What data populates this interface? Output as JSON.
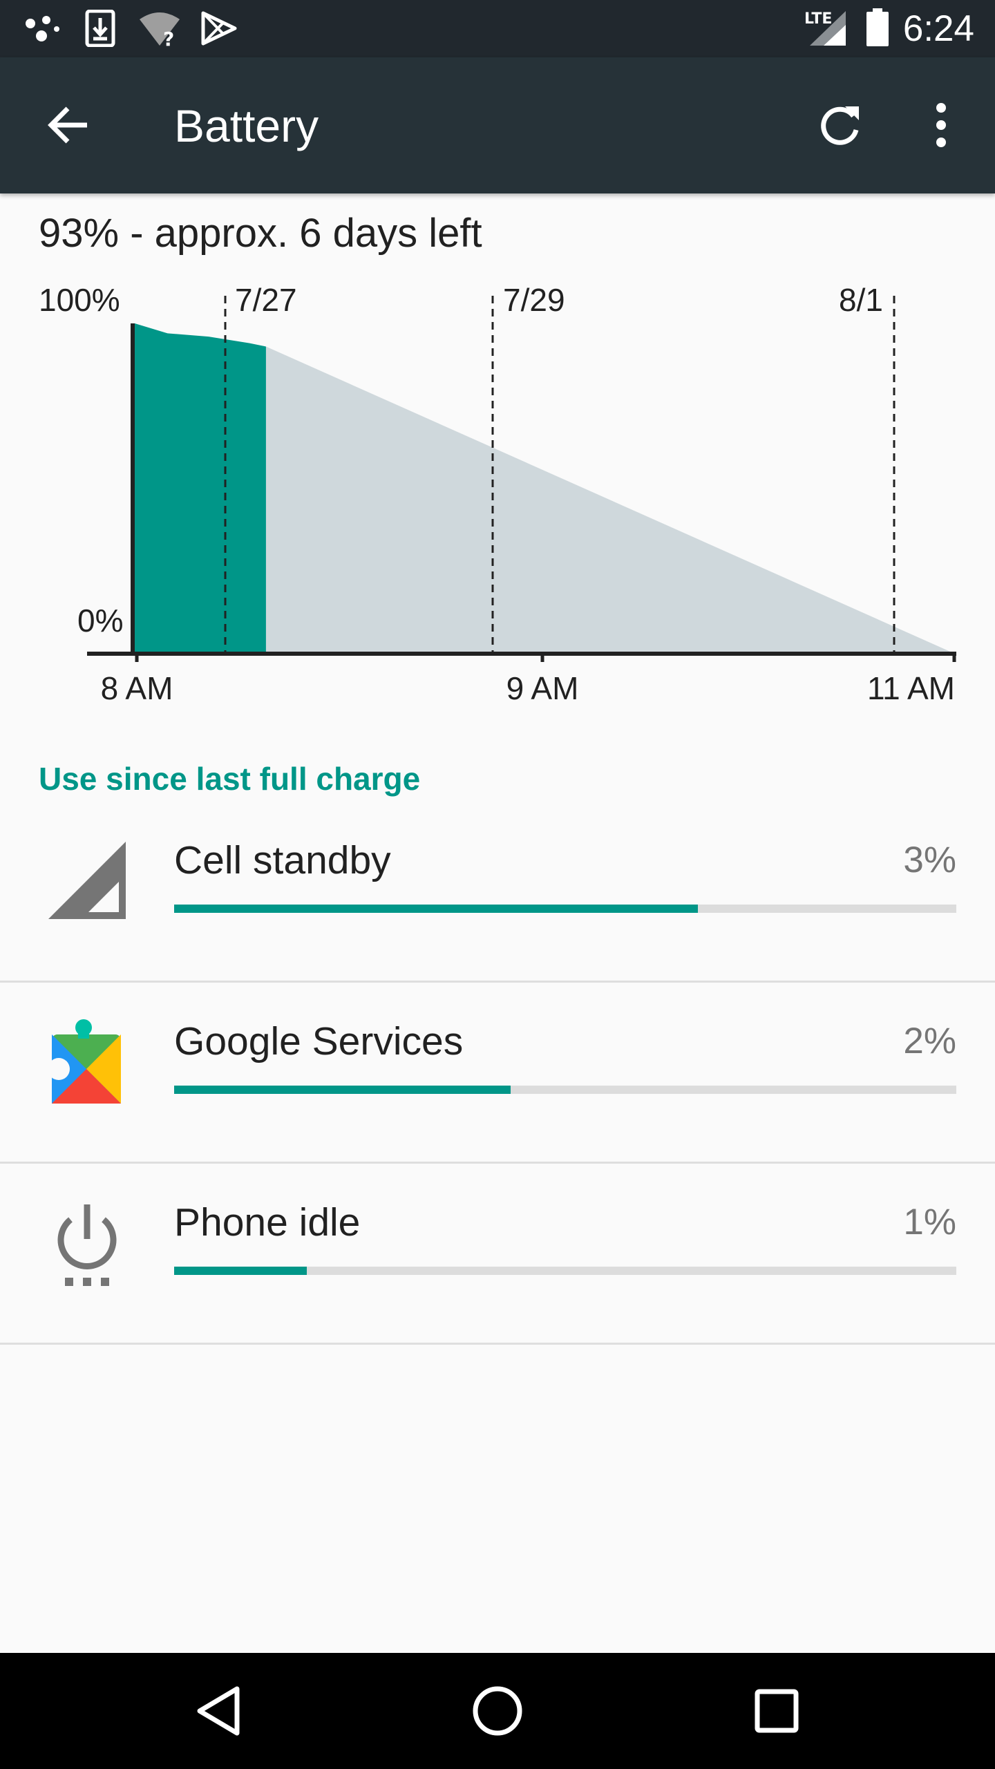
{
  "status_bar": {
    "time": "6:24",
    "network_type": "LTE",
    "icons": [
      "assistant-icon",
      "download-icon",
      "wifi-unknown-icon",
      "play-store-icon",
      "cell-signal-icon",
      "battery-icon"
    ]
  },
  "app_bar": {
    "title": "Battery",
    "icons": [
      "back-arrow-icon",
      "refresh-icon",
      "overflow-menu-icon"
    ]
  },
  "summary": "93% - approx. 6 days left",
  "chart_data": {
    "type": "area",
    "ylabels": {
      "top": "100%",
      "bottom": "0%"
    },
    "xlabels": [
      "8 AM",
      "9 AM",
      "11 AM"
    ],
    "date_markers": [
      "7/27",
      "7/29",
      "8/1"
    ],
    "series": [
      {
        "role": "actual",
        "color": "#009688"
      },
      {
        "role": "projected",
        "color": "#cfd8dc"
      }
    ],
    "actual_points": [
      [
        0,
        100
      ],
      [
        0.04,
        97
      ],
      [
        0.09,
        96
      ],
      [
        0.14,
        94
      ],
      [
        0.16,
        93
      ]
    ],
    "projected_points": [
      [
        0.16,
        93
      ],
      [
        1.0,
        0
      ]
    ]
  },
  "section_header": "Use since last full charge",
  "usage": [
    {
      "label": "Cell standby",
      "percent": "3%",
      "fill": 0.67,
      "icon": "cell-signal-icon"
    },
    {
      "label": "Google Services",
      "percent": "2%",
      "fill": 0.43,
      "icon": "google-services-icon"
    },
    {
      "label": "Phone idle",
      "percent": "1%",
      "fill": 0.17,
      "icon": "power-idle-icon"
    }
  ],
  "nav_bar": {
    "icons": [
      "back-triangle-icon",
      "home-circle-icon",
      "recents-square-icon"
    ]
  },
  "colors": {
    "accent": "#009688",
    "app_bar": "#263238",
    "status_bar": "#21282e",
    "projection": "#cfd8dc"
  }
}
